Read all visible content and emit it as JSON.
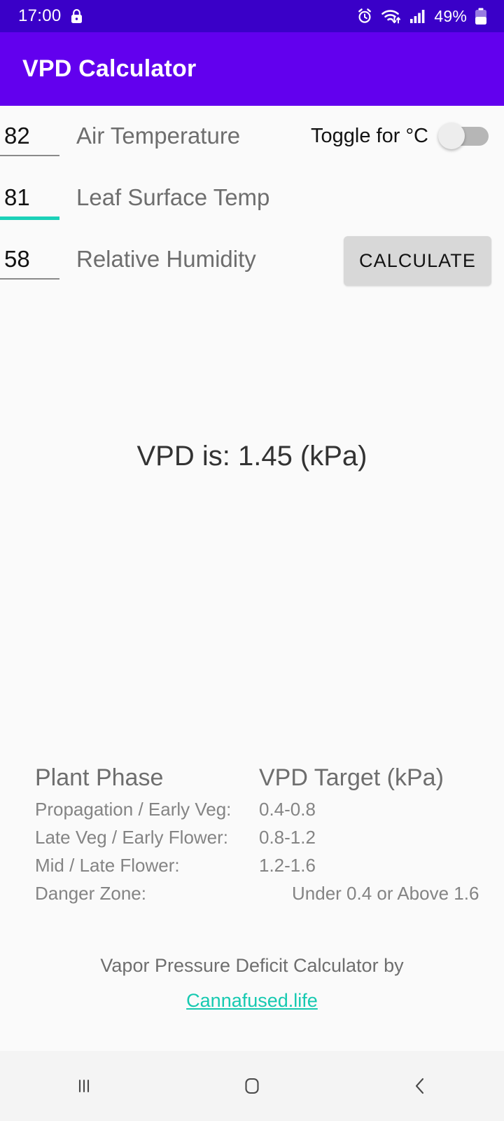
{
  "status_bar": {
    "time": "17:00",
    "battery_percent": "49%",
    "icons": [
      "lock-icon",
      "alarm-icon",
      "wifi-icon",
      "signal-icon",
      "battery-icon"
    ]
  },
  "app_bar": {
    "title": "VPD Calculator",
    "background": "#6200EE"
  },
  "form": {
    "fields": [
      {
        "value": "82",
        "label": "Air Temperature",
        "focused": false
      },
      {
        "value": "81",
        "label": "Leaf Surface Temp",
        "focused": true
      },
      {
        "value": "58",
        "label": "Relative Humidity",
        "focused": false
      }
    ],
    "toggle": {
      "label": "Toggle for °C",
      "state": "off"
    },
    "calculate_label": "CALCULATE"
  },
  "result": {
    "text": "VPD is: 1.45 (kPa)",
    "value": "1.45",
    "unit": "kPa"
  },
  "table": {
    "headers": [
      "Plant Phase",
      "VPD Target (kPa)"
    ],
    "rows": [
      {
        "phase": "Propagation / Early Veg:",
        "target": "0.4-0.8"
      },
      {
        "phase": "Late Veg / Early Flower:",
        "target": "0.8-1.2"
      },
      {
        "phase": "Mid / Late Flower:",
        "target": "1.2-1.6"
      },
      {
        "phase": "Danger Zone:",
        "target": "Under 0.4 or Above 1.6"
      }
    ]
  },
  "footer": {
    "text": "Vapor Pressure Deficit Calculator by",
    "link": "Cannafused.life",
    "link_color": "#16C9B0"
  },
  "nav_bar": {
    "buttons": [
      "recents-button",
      "home-button",
      "back-button"
    ]
  },
  "colors": {
    "status_bar": "#3A00C8",
    "app_bar": "#6200EE",
    "accent_teal": "#1BD1B8",
    "background": "#fafafa"
  }
}
